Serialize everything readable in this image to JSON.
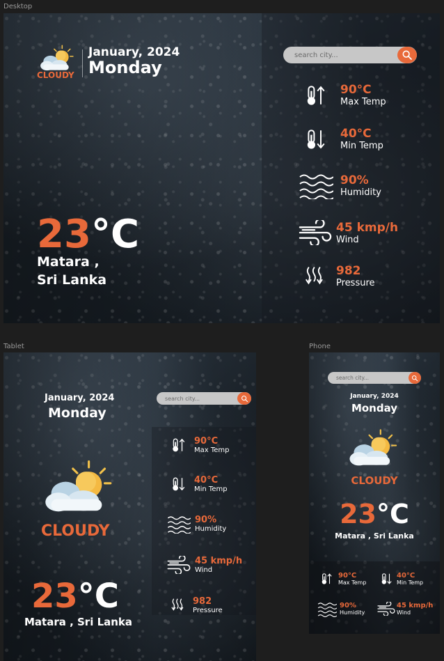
{
  "frames": {
    "desktop": "Desktop",
    "tablet": "Tablet",
    "phone": "Phone"
  },
  "weather": {
    "month_year": "January, 2024",
    "day": "Monday",
    "condition": "CLOUDY",
    "temp_num": "23",
    "temp_unit": "°C",
    "location_desktop_1": "Matara ,",
    "location_desktop_2": "Sri Lanka",
    "location": "Matara , Sri Lanka"
  },
  "search": {
    "placeholder": "search city..."
  },
  "stats": {
    "max_value": "90°C",
    "max_label": "Max Temp",
    "min_value": "40°C",
    "min_label": "Min Temp",
    "hum_value": "90%",
    "hum_label": "Humidity",
    "wind_value": "45 kmp/h",
    "wind_label": "Wind",
    "pres_value": "982",
    "pres_label": "Pressure"
  },
  "colors": {
    "accent": "#e8693a",
    "search_bg": "#c7c7c7"
  },
  "icons": [
    "cloud-sun-icon",
    "thermometer-up-icon",
    "thermometer-down-icon",
    "humidity-waves-icon",
    "wind-icon",
    "pressure-icon",
    "search-icon"
  ]
}
